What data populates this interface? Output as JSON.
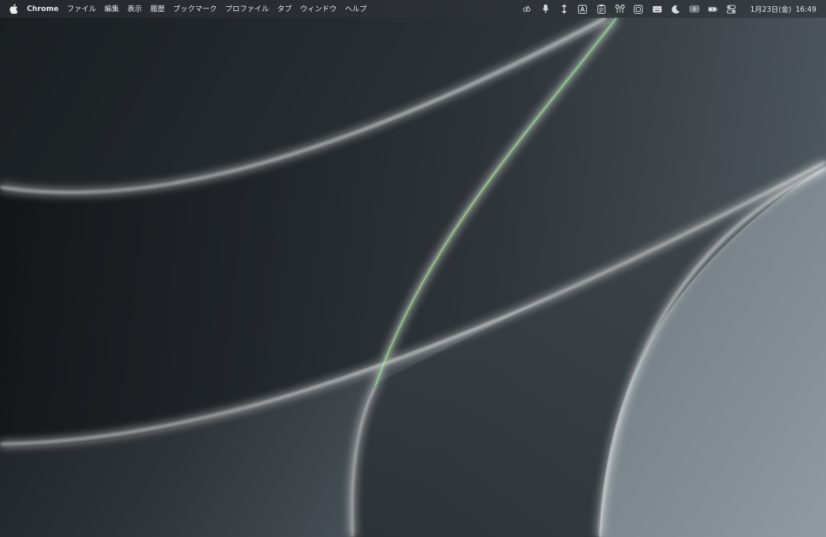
{
  "menubar": {
    "app_name": "Chrome",
    "menus": [
      "ファイル",
      "編集",
      "表示",
      "履歴",
      "ブックマーク",
      "プロファイル",
      "タブ",
      "ウィンドウ",
      "ヘルプ"
    ],
    "status_icons": [
      "clover-icon",
      "microphone-icon",
      "up-down-arrows-icon",
      "text-a-icon",
      "clipboard-icon",
      "plugs-icon",
      "app-window-icon",
      "keyboard-icon",
      "moon-icon",
      "screen-record-icon",
      "battery-charging-icon",
      "control-center-icon"
    ],
    "date": "1月23日(金)",
    "time": "16:49"
  },
  "colors": {
    "menubar_text": "#e9eaec",
    "wallpaper_dark": "#101316",
    "wallpaper_light": "#8b979c"
  }
}
